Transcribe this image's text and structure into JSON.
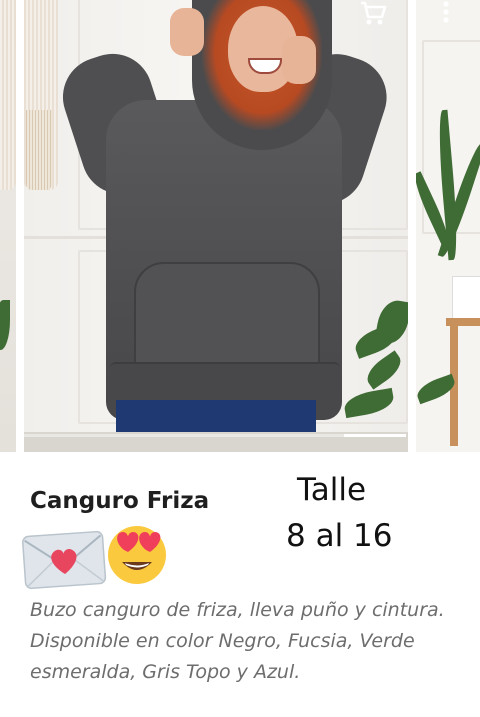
{
  "toolbar": {
    "cart_icon": "shopping-cart-icon",
    "menu_icon": "more-vertical-icon"
  },
  "carousel": {
    "image_description_icon": "product-photo",
    "slide_count_visible": 3
  },
  "product": {
    "title": "Canguro Friza",
    "size_label": "Talle",
    "size_range": "8 al 16",
    "emojis": [
      "love-letter-emoji",
      "heart-eyes-emoji"
    ],
    "description": "Buzo canguro de friza, lleva puño y cintura. Disponible en color Negro, Fucsia, Verde esmeralda, Gris Topo y Azul."
  },
  "colors": {
    "text_primary": "#1f1f1f",
    "text_description": "#6d6d6d",
    "sweatshirt_gray": "#4e4e50",
    "background": "#ffffff"
  }
}
